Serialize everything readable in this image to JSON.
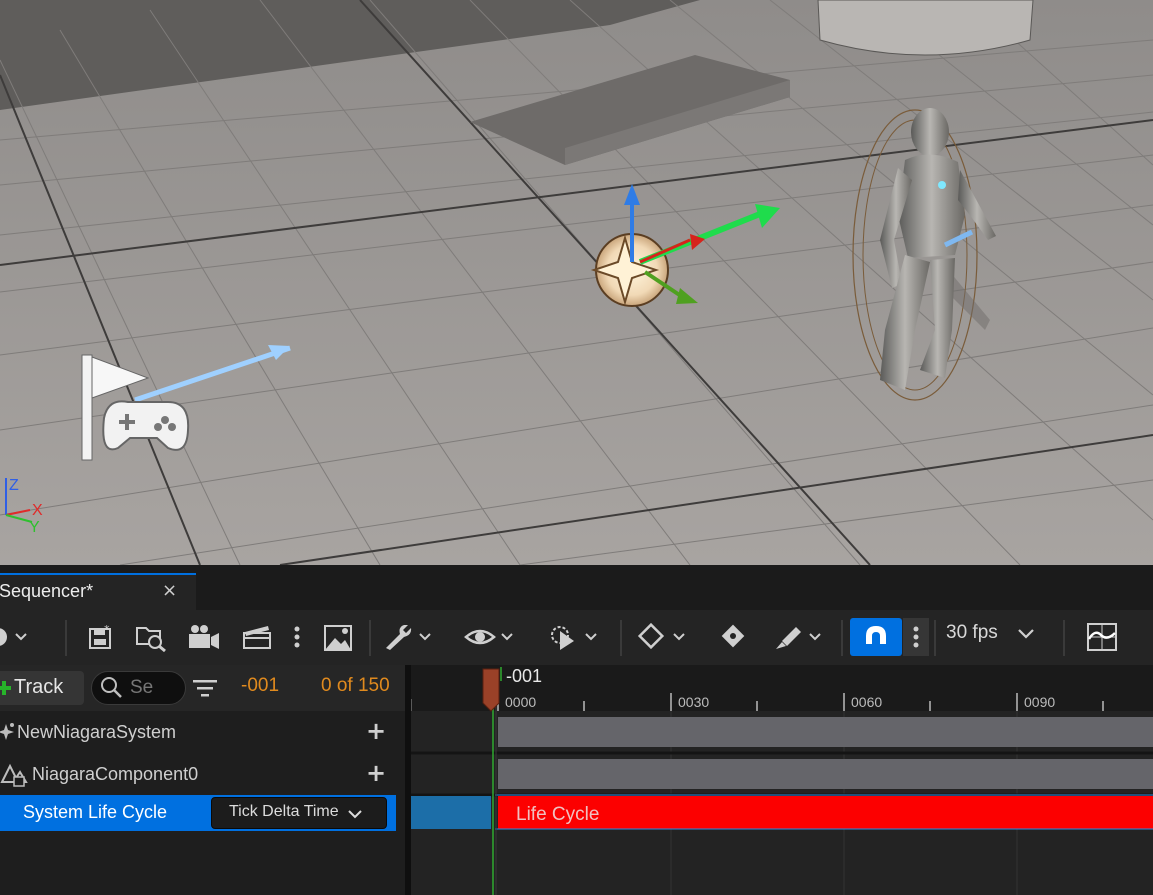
{
  "viewport": {
    "axis_gizmo": {
      "z": "Z",
      "x": "X",
      "y": "Y"
    }
  },
  "sequencer": {
    "tab_title": "Sequencer*",
    "tab_close": "×",
    "toolbar": {
      "fps_label": "30 fps",
      "icons": [
        "camera-lens-icon",
        "save-icon",
        "find-in-browser-icon",
        "add-camera-icon",
        "render-movie-icon",
        "more-icon",
        "director-icon",
        "settings-wrench-icon",
        "view-eye-icon",
        "playback-icon",
        "key-diamond-icon",
        "key-auto-icon",
        "paint-brush-icon",
        "snap-magnet-icon",
        "more-icon",
        "curve-editor-icon"
      ]
    },
    "filter_bar": {
      "track_button_label": "Track",
      "search_placeholder": "Se",
      "current_frame": "-001",
      "frame_count": "0 of 150"
    },
    "tracks": [
      {
        "label": "NewNiagaraSystem",
        "icon": "niagara-sparkle-icon"
      },
      {
        "label": "NiagaraComponent0",
        "icon": "component-icon"
      },
      {
        "label": "System Life Cycle",
        "dropdown_value": "Tick Delta Time"
      }
    ],
    "timeline": {
      "playhead_label": "-001",
      "ticks": [
        "0000",
        "0030",
        "0060",
        "0090"
      ],
      "lifecycle_label": "Life Cycle"
    }
  },
  "colors": {
    "accent_blue": "#0070e0",
    "frame_orange": "#e08a1e",
    "lifecycle_red": "#fc0000"
  }
}
